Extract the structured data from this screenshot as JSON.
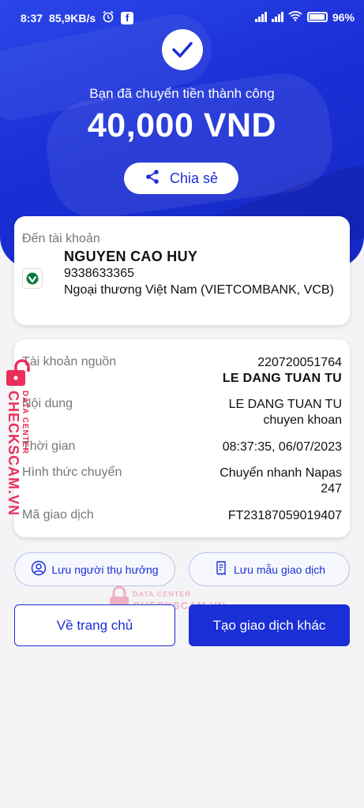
{
  "status_bar": {
    "time": "8:37",
    "speed": "85,9KB/s",
    "battery": "96"
  },
  "hero": {
    "success_message": "Bạn đã chuyển tiền thành công",
    "amount": "40,000 VND",
    "share_label": "Chia sẻ"
  },
  "recipient": {
    "label": "Đến tài khoản",
    "name": "NGUYEN CAO HUY",
    "account_number": "9338633365",
    "bank": "Ngoại thương Việt Nam (VIETCOMBANK, VCB)"
  },
  "details": {
    "source_label": "Tài khoản nguồn",
    "source_account": "220720051764",
    "source_name": "LE DANG TUAN TU",
    "content_label": "Nội dung",
    "content_line1": "LE DANG TUAN TU",
    "content_line2": "chuyen khoan",
    "time_label": "Thời gian",
    "time_value": "08:37:35, 06/07/2023",
    "method_label": "Hình thức chuyển",
    "method_line1": "Chuyển nhanh Napas",
    "method_line2": "247",
    "txn_label": "Mã giao dịch",
    "txn_value": "FT23187059019407"
  },
  "actions": {
    "save_beneficiary": "Lưu người thụ hưởng",
    "save_template": "Lưu mẫu giao dịch",
    "home": "Về trang chủ",
    "new_transaction": "Tạo giao dịch khác"
  },
  "watermark": {
    "small": "DATA CENTER",
    "brand": "CHECKSCAM.VN"
  },
  "colors": {
    "primary": "#1b2fd6",
    "watermark": "#e8194a"
  }
}
